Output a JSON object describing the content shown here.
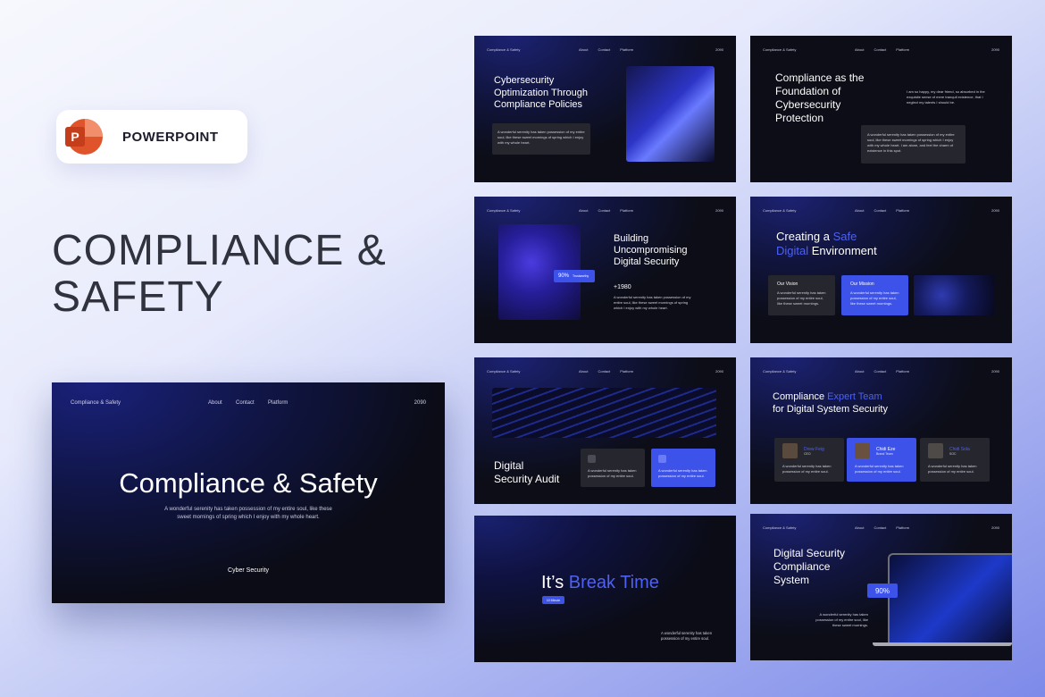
{
  "badge": {
    "label": "POWERPOINT"
  },
  "title": {
    "line1": "COMPLIANCE &",
    "line2": "SAFETY"
  },
  "slide_header": {
    "brand": "Compliance & Safety",
    "nav": [
      "About",
      "Contact",
      "Platform"
    ],
    "year": "2090"
  },
  "cover": {
    "title": "Compliance & Safety",
    "desc1": "A wonderful serenity has taken possession of my entire soul, like these",
    "desc2": "sweet mornings of spring which I enjoy with my whole heart.",
    "footer": "Cyber Security"
  },
  "s1": {
    "t1": "Cybersecurity",
    "t2": "Optimization Through",
    "t3": "Compliance Policies",
    "card": "A wonderful serenity has taken possession of my entire soul, like these sweet mornings of spring which I enjoy with my whole heart."
  },
  "s2": {
    "t1": "Compliance as the",
    "t2": "Foundation of",
    "t3": "Cybersecurity",
    "t4": "Protection",
    "note": "I am so happy, my dear friend, so absorbed in the exquisite sense of mere tranquil existence, that I neglect my talents I should be.",
    "card": "A wonderful serenity has taken possession of my entire soul, like these sweet mornings of spring which I enjoy with my whole heart. I am alone, and feel the charm of existence in this spot."
  },
  "s3": {
    "t1": "Building",
    "t2": "Uncompromising",
    "t3": "Digital Security",
    "pct": "90%",
    "pct_label": "Trustworthy",
    "num": "+1980",
    "body": "A wonderful serenity has taken possession of my entire soul, like these sweet mornings of spring which I enjoy with my whole heart."
  },
  "s4": {
    "t1a": "Creating a ",
    "t1b": "Safe",
    "t2a": "Digital",
    "t2b": " Environment",
    "vision": "Our Vision",
    "vision_body": "A wonderful serenity has taken possession of my entire soul, like these sweet mornings.",
    "mission": "Our Mission",
    "mission_body": "A wonderful serenity has taken possession of my entire soul, like these sweet mornings."
  },
  "s5": {
    "t1": "Digital",
    "t2": "Security Audit",
    "c1": "A wonderful serenity has taken possession of my entire soul.",
    "c2": "A wonderful serenity has taken possession of my entire soul."
  },
  "s6": {
    "t1a": "Compliance ",
    "t1b": "Expert Team",
    "t2": "for Digital System Security",
    "members": [
      {
        "name": "Drew Feig",
        "role": "CEO"
      },
      {
        "name": "Chidi Eze",
        "role": "Brand Team"
      },
      {
        "name": "Chidi Sola",
        "role": "SOC"
      }
    ],
    "body": "A wonderful serenity has taken possession of my entire soul."
  },
  "s7": {
    "t1a": "It’s ",
    "t1b": "Break Time",
    "tag": "10 Minute",
    "body": "A wonderful serenity has taken possession of my entire soul."
  },
  "s8": {
    "t1": "Digital Security",
    "t2": "Compliance",
    "t3": "System",
    "pct": "90%",
    "body": "A wonderful serenity has taken possession of my entire soul, like these sweet mornings."
  }
}
